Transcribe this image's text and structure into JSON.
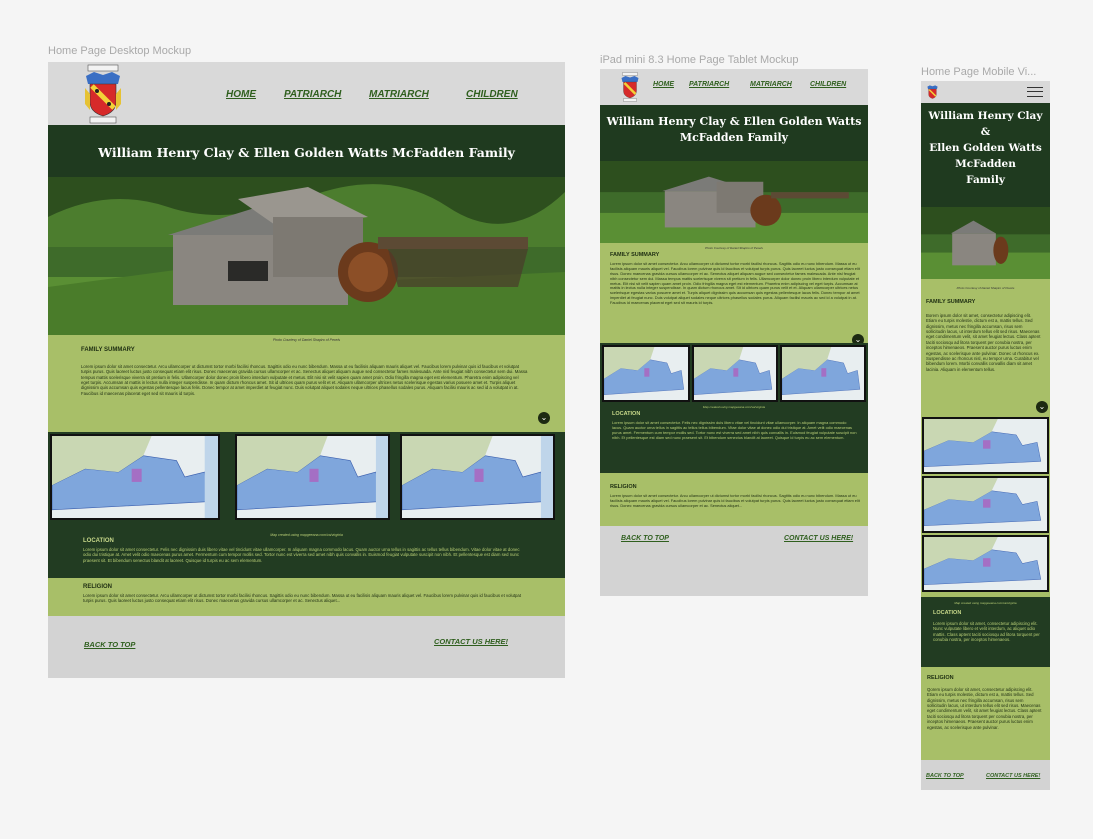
{
  "labels": {
    "desktop": "Home Page Desktop Mockup",
    "tablet": "iPad mini 8.3  Home Page Tablet Mockup",
    "mobile": "Home Page Mobile Vi..."
  },
  "nav": {
    "home": "HOME",
    "patriarch": "PATRIARCH",
    "matriarch": "MATRIARCH",
    "children": "CHILDREN"
  },
  "title": {
    "full": "William Henry Clay  & Ellen Golden Watts McFadden Family",
    "tablet_line1": "William Henry Clay  & Ellen Golden Watts",
    "tablet_line2": "McFadden Family",
    "mobile_line1": "William Henry Clay",
    "mobile_line2": "&",
    "mobile_line3": "Ellen Golden Watts",
    "mobile_line4": "McFadden",
    "mobile_line5": "Family"
  },
  "photo_caption": "Photo Courtesy of Daniel Shapiro of Pexels",
  "map_caption": "Map created using mapgeeana.com/va/virginia",
  "family_summary": {
    "heading": "FAMILY SUMMARY",
    "text": "Lorem ipsum dolor sit amet consectetur. Arcu ullamcorper ut dictumst tortor morbi facilisi rhoncus. Sagittis odio eu nunc bibendum. Massa ut eu facilisis aliquam mauris aliquet vel. Faucibus lorem pulvinar quis id faucibus et volutpat turpis purus. Quis laoreet luctus justo consequat etiam elit risus. Donec maecenas gravida cursus ullamcorper et ac. Senectus aliquet aliquam augue sed consectetur fames malesuada. Ante nisl feugiat nibh consectetur sem dui. Massa tempus mattis scelerisque viverra sit pretium in felis. Ullamcorper dolor donec proin libero interdum vulputate et metus. Elit nisi sit velit sapien quam amet proin. Odio fringilla magna eget est elementum. Pharetra enim adipiscing vel eget turpis. Accumsan at mattis in lectus nulla integer suspendisse. In quam dictum rhoncus amet. Sit id ultrices quam purus velit et et. Aliquam ullamcorper ultrices netus scelerisque egestas varius posuere amet et. Turpis aliquet dignissim quis accumsan quis egestas pellentesque lacus felis. Donec tempor at amet imperdiet at feugiat nunc. Duis volutpat aliquet sodales neque ultrices phasellus sodales purus. Aliquam facilisi mauris ac sed id a volutpat in at. Faucibus id maecenas placerat eget sed sit mauris id turpis.",
    "mobile_text": "Borem ipsum dolor sit amet, consectetur adipiscing elit. Etiam eu turpis molestie, dictum est a, mattis tellus. Sed dignissim, metus nec fringilla accumsan, risus sem sollicitudin lacus, ut interdum tellus elit sed risus. Maecenas eget condimentum velit, sit amet feugiat lectus. Class aptent taciti sociosqu ad litora torquent per conubia nostra, per inceptos himenaeos. Praesent auctor purus luctus enim egestas, ac scelerisque ante pulvinar. Donec ut rhoncus ex. Suspendisse ac rhoncus nisl, eu tempor urna. Curabitur vel bibendum lorem. Morbi convallis convallis diam sit amet lacinia. Aliquam in elementum tellus."
  },
  "location": {
    "heading": "LOCATION",
    "text": "Lorem ipsum dolor sit amet consectetur. Felis nec dignissim duis libero vitae vel tincidunt vitae ullamcorper. In aliquam magna commodo lacus. Quam auctor urna tellus in sagittis ac tellus tellus bibendum. Vitae dolor vitae at donec odio dui tristique at. Amet velit odio maecenas purus amet. Fermentum cum tempor mollis sed. Tortor nunc est viverra sed amet nibh quis convallis in. Euismod feugiat vulputate suscipit non nibh. Et pellentesque est diam sed nunc praesent sit. Et bibendum senectus blandit at laoreet. Quisque id turpis eu ac sem elementum.",
    "mobile_text": "Lorem ipsum dolor sit amet, consectetur adipiscing elit. Nunc vulputate libero et velit interdum, ac aliquet odio mattis. Class aptent taciti sociosqu ad litora torquent per conubia nostra, per inceptos himenaeos."
  },
  "religion": {
    "heading": "RELIGION",
    "text": "Lorem ipsum dolor sit amet consectetur. Arcu ullamcorper ut dictumst tortor morbi facilisi rhoncus. Sagittis odio eu nunc bibendum. Massa ut eu facilisis aliquam mauris aliquet vel. Faucibus lorem pulvinar quis id faucibus et volutpat turpis purus. Quis laoreet luctus justo consequat etiam elit risus. Donec maecenas gravida cursus ullamcorper et ac. Senectus aliquet...",
    "mobile_text": "Qorem ipsum dolor sit amet, consectetur adipiscing elit. Etiam eu turpis molestie, dictum est a, mattis tellus. Sed dignissim, metus nec fringilla accumsan, risus sem sollicitudin lacus, ut interdum tellus elit sed risus. Maecenas eget condimentum velit, sit amet feugiat lectus. Class aptent taciti sociosqu ad litora torquent per conubia nostra, per inceptos himenaeos. Praesent auctor purus luctus enim egestas, ac scelerisque ante pulvinar."
  },
  "footer": {
    "back_to_top": "BACK TO TOP",
    "contact": "CONTACT US HERE!"
  },
  "colors": {
    "dark_green": "#223c22",
    "olive": "#a8bf68",
    "link_green": "#2f5f1e"
  }
}
